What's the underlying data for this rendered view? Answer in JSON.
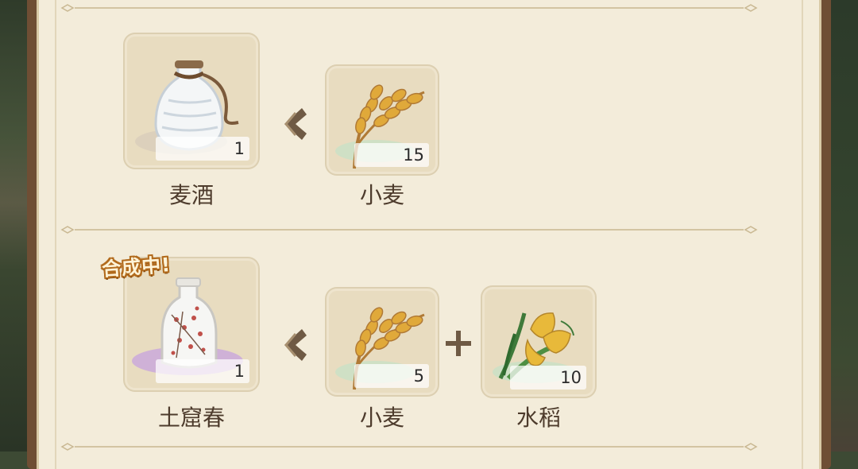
{
  "badge": "合成中!",
  "recipes": [
    {
      "output": {
        "name": "麦酒",
        "count": "1",
        "icon": "white-bottle-icon"
      },
      "inputs": [
        {
          "name": "小麦",
          "count": "15",
          "icon": "wheat-icon"
        }
      ]
    },
    {
      "output": {
        "name": "土窟春",
        "count": "1",
        "icon": "flower-porcelain-bottle-icon",
        "status": "合成中!"
      },
      "inputs": [
        {
          "name": "小麦",
          "count": "5",
          "icon": "wheat-icon"
        },
        {
          "name": "水稻",
          "count": "10",
          "icon": "rice-plant-icon"
        }
      ]
    }
  ],
  "colors": {
    "panel_bg": "#f3ecda",
    "slot_bg": "#e8dcc0",
    "label_text": "#4d3b2c",
    "badge_outline": "#b26b1d",
    "crafting_glow": "#c8a6dc"
  }
}
